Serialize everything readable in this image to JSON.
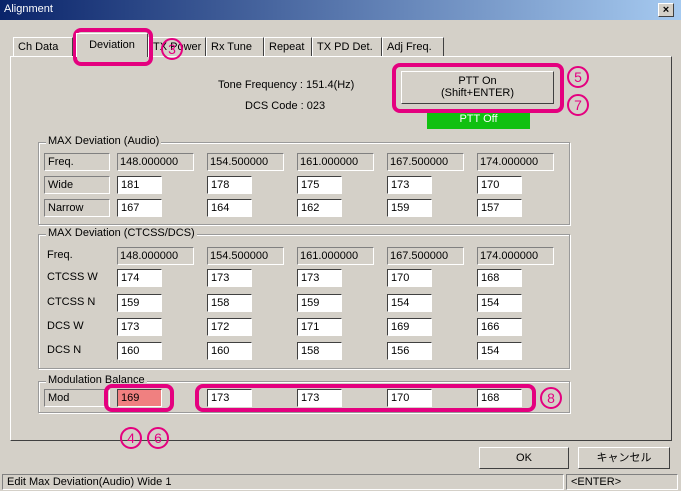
{
  "window": {
    "title": "Alignment",
    "close_label": "×"
  },
  "tabs": [
    "Ch Data",
    "Deviation",
    "TX Power",
    "Rx Tune",
    "Repeat",
    "TX PD Det.",
    "Adj Freq."
  ],
  "info": {
    "tone_frequency": "Tone Frequency : 151.4(Hz)",
    "dcs_code": "DCS Code : 023"
  },
  "ptt": {
    "button_line1": "PTT On",
    "button_line2": "(Shift+ENTER)",
    "status": "PTT Off"
  },
  "audio_group": {
    "title": "MAX Deviation (Audio)",
    "freq_label": "Freq.",
    "freqs": [
      "148.000000",
      "154.500000",
      "161.000000",
      "167.500000",
      "174.000000"
    ],
    "rows": [
      {
        "label": "Wide",
        "values": [
          "181",
          "178",
          "175",
          "173",
          "170"
        ]
      },
      {
        "label": "Narrow",
        "values": [
          "167",
          "164",
          "162",
          "159",
          "157"
        ]
      }
    ]
  },
  "ctcss_group": {
    "title": "MAX Deviation (CTCSS/DCS)",
    "freq_label": "Freq.",
    "freqs": [
      "148.000000",
      "154.500000",
      "161.000000",
      "167.500000",
      "174.000000"
    ],
    "rows": [
      {
        "label": "CTCSS W",
        "values": [
          "174",
          "173",
          "173",
          "170",
          "168"
        ]
      },
      {
        "label": "CTCSS N",
        "values": [
          "159",
          "158",
          "159",
          "154",
          "154"
        ]
      },
      {
        "label": "DCS W",
        "values": [
          "173",
          "172",
          "171",
          "169",
          "166"
        ]
      },
      {
        "label": "DCS N",
        "values": [
          "160",
          "160",
          "158",
          "156",
          "154"
        ]
      }
    ]
  },
  "mod_group": {
    "title": "Modulation Balance",
    "label": "Mod",
    "values": [
      "169",
      "173",
      "173",
      "170",
      "168"
    ]
  },
  "buttons": {
    "ok": "OK",
    "cancel": "キャンセル"
  },
  "status": {
    "message": "Edit Max Deviation(Audio) Wide 1",
    "key": "<ENTER>"
  },
  "callouts": {
    "c3": "3",
    "c4": "4",
    "c5": "5",
    "c6": "6",
    "c7": "7",
    "c8": "8"
  },
  "colors": {
    "callout": "#e4007f",
    "ptt_status_bg": "#10c010",
    "mod_highlight": "#f08080",
    "titlebar": "#0a246a"
  }
}
